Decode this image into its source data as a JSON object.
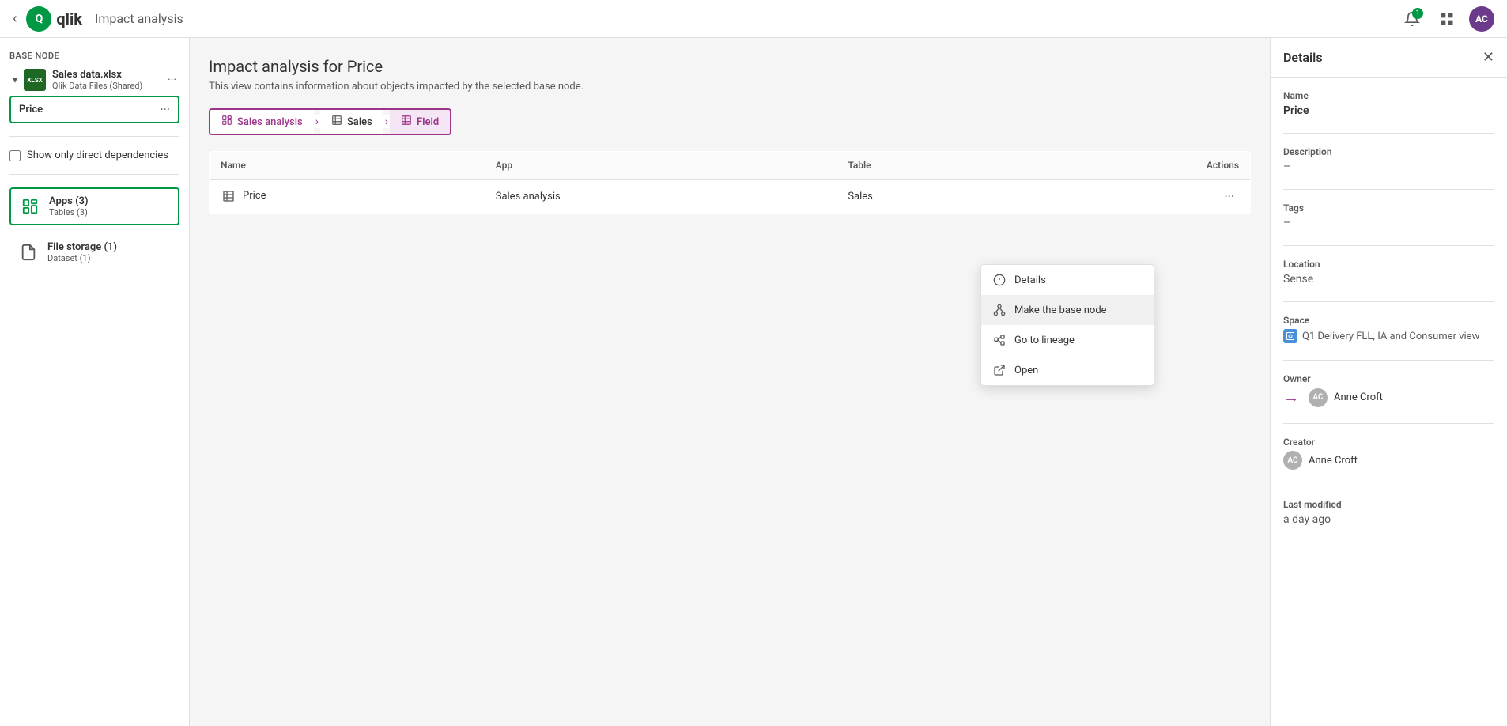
{
  "topbar": {
    "back_label": "‹",
    "app_name": "Q",
    "page_title": "Impact analysis",
    "notification_count": "1"
  },
  "sidebar": {
    "base_node_label": "Base node",
    "file_name": "Sales data.xlsx",
    "file_sub": "Qlik Data Files (Shared)",
    "price_label": "Price",
    "more_icon": "···",
    "checkbox_label": "Show only direct dependencies",
    "apps_label": "Apps",
    "apps_count": "(3)",
    "apps_sub": "Tables (3)",
    "file_storage_label": "File storage",
    "file_storage_count": "(1)",
    "file_storage_sub": "Dataset (1)"
  },
  "breadcrumb": {
    "items": [
      {
        "label": "Sales analysis",
        "icon": "chart"
      },
      {
        "label": "Sales",
        "icon": "table"
      },
      {
        "label": "Field",
        "icon": "field"
      }
    ]
  },
  "content": {
    "title": "Impact analysis for Price",
    "subtitle": "This view contains information about objects impacted by the selected base node.",
    "table": {
      "columns": [
        "Name",
        "App",
        "Table",
        "Actions"
      ],
      "rows": [
        {
          "name": "Price",
          "app": "Sales analysis",
          "table": "Sales"
        }
      ]
    }
  },
  "context_menu": {
    "items": [
      {
        "label": "Details",
        "icon": "info"
      },
      {
        "label": "Make the base node",
        "icon": "lineage"
      },
      {
        "label": "Go to lineage",
        "icon": "lineage2"
      },
      {
        "label": "Open",
        "icon": "open"
      }
    ]
  },
  "details_panel": {
    "title": "Details",
    "close_icon": "✕",
    "name_label": "Name",
    "name_value": "Price",
    "description_label": "Description",
    "description_value": "–",
    "tags_label": "Tags",
    "tags_value": "–",
    "location_label": "Location",
    "location_value": "Sense",
    "space_label": "Space",
    "space_value": "Q1 Delivery FLL, IA and Consumer view",
    "owner_label": "Owner",
    "owner_value": "Anne Croft",
    "creator_label": "Creator",
    "creator_value": "Anne Croft",
    "last_modified_label": "Last modified",
    "last_modified_value": "a day ago"
  }
}
